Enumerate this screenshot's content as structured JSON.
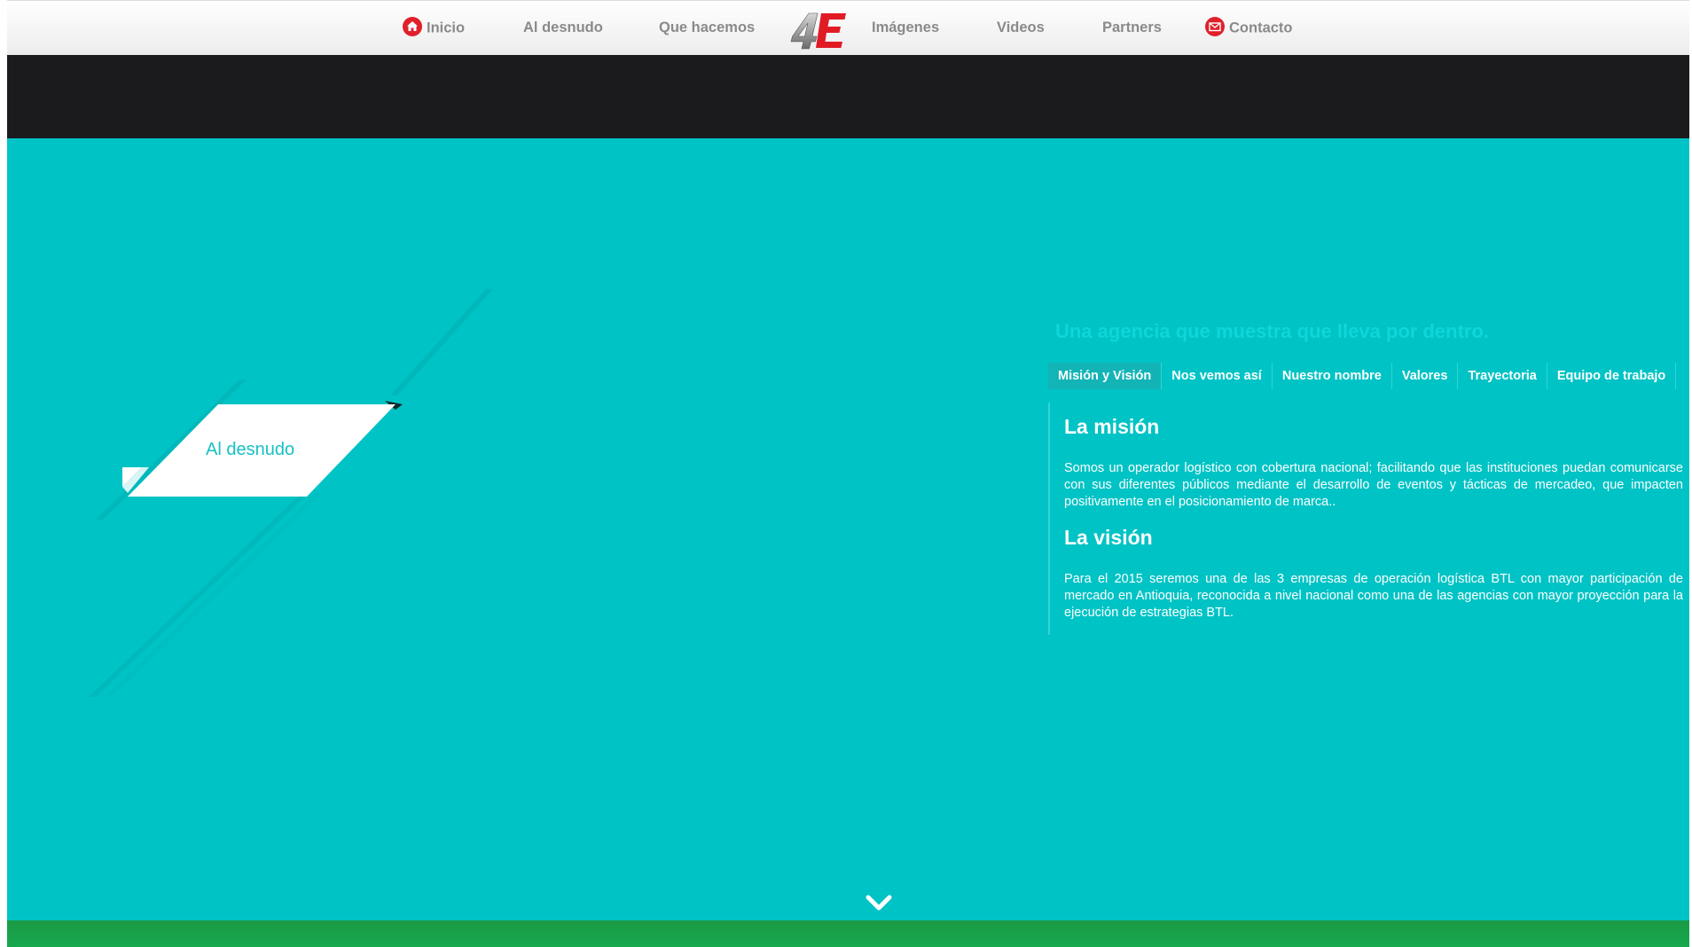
{
  "nav": {
    "items": [
      {
        "label": "Inicio",
        "icon": "home-icon"
      },
      {
        "label": "Al desnudo"
      },
      {
        "label": "Que hacemos"
      },
      {
        "label": "Imágenes"
      },
      {
        "label": "Videos"
      },
      {
        "label": "Partners"
      },
      {
        "label": "Contacto",
        "icon": "mail-icon"
      }
    ],
    "logo_text": "4E"
  },
  "ribbon": {
    "label": "Al desnudo"
  },
  "content": {
    "tagline": "Una agencia que muestra que lleva por dentro.",
    "tabs": [
      {
        "label": "Misión y Visión",
        "active": true
      },
      {
        "label": "Nos vemos así"
      },
      {
        "label": "Nuestro nombre"
      },
      {
        "label": "Valores"
      },
      {
        "label": "Trayectoria"
      },
      {
        "label": "Equipo de trabajo"
      }
    ],
    "mision": {
      "title": "La misión",
      "text": "Somos un operador logístico con cobertura nacional; facilitando que las instituciones puedan comunicarse con sus diferentes públicos mediante el desarrollo de eventos y tácticas de mercadeo, que impacten positivamente en el posicionamiento de marca.."
    },
    "vision": {
      "title": "La visión",
      "text": "Para el 2015 seremos una de las 3 empresas de operación logística BTL con mayor participación de mercado en Antioquia, reconocida a nivel nacional como una de las agencias con mayor proyección para la ejecución de estrategias BTL."
    }
  },
  "colors": {
    "teal": "#00c3c5",
    "dark_band": "#1b1b1d",
    "accent_red": "#e0202a",
    "green_band": "#17a84e"
  },
  "scroll_icon": "chevron-down-icon"
}
